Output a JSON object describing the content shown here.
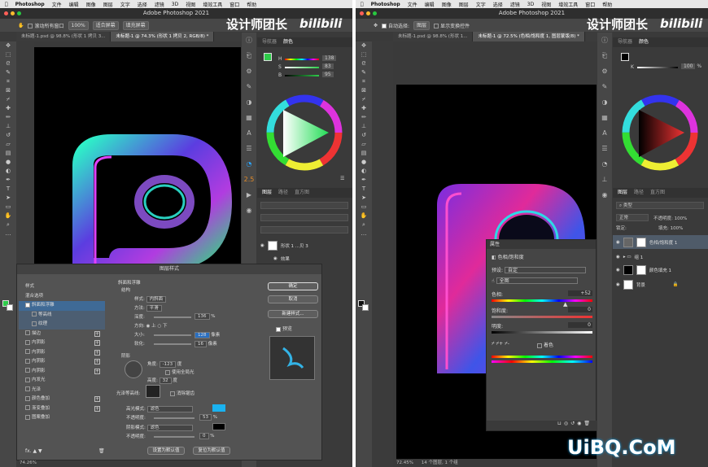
{
  "left": {
    "menu": {
      "app": "Photoshop",
      "items": [
        "文件",
        "编辑",
        "图像",
        "图层",
        "文字",
        "选择",
        "滤镜",
        "3D",
        "视图",
        "增效工具",
        "窗口",
        "帮助"
      ]
    },
    "window_title": "Adobe Photoshop 2021",
    "options": {
      "scroll_all": "滚动所有窗口",
      "zoom": "100%",
      "fit_screen": "适合屏幕",
      "fill_screen": "填充屏幕"
    },
    "tabs": [
      "未标题-1.psd @ 98.8% (形状 1 拷贝 3...",
      "未标题-1 @ 74.3% (形状 1 拷贝 2, RGB/8) *"
    ],
    "panel_tabs": [
      "导航器",
      "颜色"
    ],
    "color_values": {
      "h": "138",
      "s": "83",
      "b": "95"
    },
    "layer_tabs": [
      "图层",
      "路径",
      "直方图"
    ],
    "layer_name": "形状 1 ...贝 3",
    "effect_label": "效果",
    "zoom_status": "74.26%",
    "dialog": {
      "title": "图层样式",
      "left_items": [
        "样式",
        "混合选项",
        "斜面和浮雕",
        "等高线",
        "纹理",
        "描边",
        "内阴影",
        "内阴影",
        "内阴影",
        "内阴影",
        "内发光",
        "光泽",
        "颜色叠加",
        "渐变叠加",
        "图案叠加"
      ],
      "section": "斜面和浮雕",
      "structure": "结构",
      "style_label": "样式:",
      "style_value": "内斜面",
      "method_label": "方法:",
      "method_value": "平滑",
      "depth_label": "深度:",
      "depth_value": "136",
      "percent": "%",
      "direction_label": "方向:",
      "dir_up": "上",
      "dir_down": "下",
      "size_label": "大小:",
      "size_value": "128",
      "px": "像素",
      "soften_label": "软化:",
      "soften_value": "16",
      "shading": "阴影",
      "angle_label": "角度:",
      "angle_value": "-123",
      "degree": "度",
      "global_light": "使用全局光",
      "altitude_label": "高度:",
      "altitude_value": "32",
      "gloss_label": "光泽等高线:",
      "antialias": "消除锯齿",
      "highlight_mode_label": "高光模式:",
      "highlight_mode": "滤色",
      "highlight_color": "#1ab2f0",
      "opacity_label": "不透明度:",
      "hl_opacity": "53",
      "shadow_mode_label": "阴影模式:",
      "shadow_mode": "滤色",
      "shadow_color": "#000000",
      "sh_opacity": "0",
      "ok": "确定",
      "cancel": "取消",
      "new_style": "新建样式...",
      "preview": "预览",
      "make_default": "设置为默认值",
      "reset_default": "复位为默认值",
      "fx": "fx."
    }
  },
  "right": {
    "menu": {
      "app": "Photoshop",
      "items": [
        "文件",
        "编辑",
        "图像",
        "图层",
        "文字",
        "选择",
        "滤镜",
        "3D",
        "视图",
        "增效工具",
        "窗口",
        "帮助"
      ]
    },
    "window_title": "Adobe Photoshop 2021",
    "options": {
      "auto_select": "自动选择:",
      "layer": "图层",
      "transform": "显示变换控件"
    },
    "tabs": [
      "未标题-1.psd @ 98.8% (形状 1...",
      "未标题-1 @ 72.5% (色相/饱和度 1, 图层蒙版/8) *"
    ],
    "panel_tabs": [
      "导航器",
      "颜色"
    ],
    "k_value": "100",
    "k_label": "K",
    "percent": "%",
    "props": {
      "title": "属性",
      "subtitle": "色相/饱和度",
      "preset_label": "预设:",
      "preset_value": "自定",
      "channel": "全图",
      "hue_label": "色相:",
      "hue_value": "+52",
      "sat_label": "饱和度:",
      "sat_value": "0",
      "light_label": "明度:",
      "light_value": "0",
      "colorize": "着色"
    },
    "layer_tabs": [
      "图层",
      "路径",
      "直方图"
    ],
    "blend": "正常",
    "opacity_label": "不透明度:",
    "opacity_value": "100%",
    "fill_label": "填充:",
    "fill_value": "100%",
    "lock_label": "锁定:",
    "kind": "类型",
    "layers": [
      "色相/饱和度 1",
      "组 1",
      "颜色填充 1",
      "背景"
    ],
    "status": "72.45%",
    "status_text": "14 个图层, 1 个组"
  },
  "watermark": {
    "text": "设计师团长",
    "logo": "bilibili",
    "site": "UiBQ.CoM"
  }
}
